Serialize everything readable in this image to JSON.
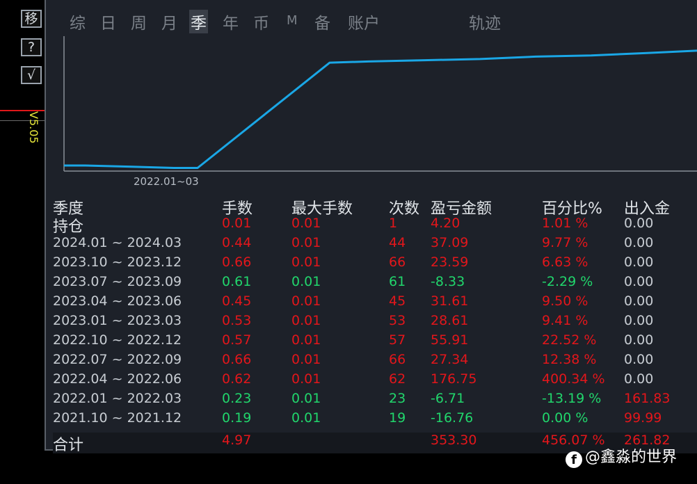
{
  "sidebar": {
    "move_label": "移",
    "help_label": "?",
    "check_label": "√",
    "version": "V5.05"
  },
  "tabs": [
    {
      "label": "综",
      "active": false
    },
    {
      "label": "日",
      "active": false
    },
    {
      "label": "周",
      "active": false
    },
    {
      "label": "月",
      "active": false
    },
    {
      "label": "季",
      "active": true
    },
    {
      "label": "年",
      "active": false
    },
    {
      "label": "币",
      "active": false
    },
    {
      "label": "M",
      "active": false
    },
    {
      "label": "备",
      "active": false
    },
    {
      "label": "账户",
      "active": false
    },
    {
      "label": "轨迹",
      "active": false
    }
  ],
  "chart_data": {
    "type": "line",
    "x_tick_label": "2022.01~03",
    "series": [
      {
        "color": "#1aa7e6",
        "points_relative": [
          0.0,
          0.0,
          -0.01,
          -0.02,
          -0.02,
          0.85,
          0.86,
          0.87,
          0.88,
          0.9,
          0.91,
          0.93,
          0.95
        ]
      }
    ]
  },
  "table": {
    "headers": [
      "季度",
      "手数",
      "最大手数",
      "次数",
      "盈亏金额",
      "百分比%",
      "出入金"
    ],
    "rows": [
      {
        "period": "持仓",
        "lots": "0.01",
        "max_lots": "0.01",
        "count": "1",
        "pnl": "4.20",
        "pct": "1.01 %",
        "flow": "0.00",
        "color": "red",
        "flow_color": "white"
      },
      {
        "period": "2024.01 ~ 2024.03",
        "lots": "0.44",
        "max_lots": "0.01",
        "count": "44",
        "pnl": "37.09",
        "pct": "9.77 %",
        "flow": "0.00",
        "color": "red",
        "flow_color": "white"
      },
      {
        "period": "2023.10 ~ 2023.12",
        "lots": "0.66",
        "max_lots": "0.01",
        "count": "66",
        "pnl": "23.59",
        "pct": "6.63 %",
        "flow": "0.00",
        "color": "red",
        "flow_color": "white"
      },
      {
        "period": "2023.07 ~ 2023.09",
        "lots": "0.61",
        "max_lots": "0.01",
        "count": "61",
        "pnl": "-8.33",
        "pct": "-2.29 %",
        "flow": "0.00",
        "color": "green",
        "flow_color": "white"
      },
      {
        "period": "2023.04 ~ 2023.06",
        "lots": "0.45",
        "max_lots": "0.01",
        "count": "45",
        "pnl": "31.61",
        "pct": "9.50 %",
        "flow": "0.00",
        "color": "red",
        "flow_color": "white"
      },
      {
        "period": "2023.01 ~ 2023.03",
        "lots": "0.53",
        "max_lots": "0.01",
        "count": "53",
        "pnl": "28.61",
        "pct": "9.41 %",
        "flow": "0.00",
        "color": "red",
        "flow_color": "white"
      },
      {
        "period": "2022.10 ~ 2022.12",
        "lots": "0.57",
        "max_lots": "0.01",
        "count": "57",
        "pnl": "55.91",
        "pct": "22.52 %",
        "flow": "0.00",
        "color": "red",
        "flow_color": "white"
      },
      {
        "period": "2022.07 ~ 2022.09",
        "lots": "0.66",
        "max_lots": "0.01",
        "count": "66",
        "pnl": "27.34",
        "pct": "12.38 %",
        "flow": "0.00",
        "color": "red",
        "flow_color": "white"
      },
      {
        "period": "2022.04 ~ 2022.06",
        "lots": "0.62",
        "max_lots": "0.01",
        "count": "62",
        "pnl": "176.75",
        "pct": "400.34 %",
        "flow": "0.00",
        "color": "red",
        "flow_color": "white"
      },
      {
        "period": "2022.01 ~ 2022.03",
        "lots": "0.23",
        "max_lots": "0.01",
        "count": "23",
        "pnl": "-6.71",
        "pct": "-13.19 %",
        "flow": "161.83",
        "color": "green",
        "flow_color": "red"
      },
      {
        "period": "2021.10 ~ 2021.12",
        "lots": "0.19",
        "max_lots": "0.01",
        "count": "19",
        "pnl": "-16.76",
        "pct": "0.00 %",
        "flow": "99.99",
        "color": "green",
        "flow_color": "red"
      }
    ],
    "total": {
      "period": "合计",
      "lots": "4.97",
      "max_lots": "",
      "count": "",
      "pnl": "353.30",
      "pct": "456.07 %",
      "flow": "261.82"
    }
  },
  "watermark": {
    "icon": "f",
    "text": "@鑫淼的世界"
  }
}
